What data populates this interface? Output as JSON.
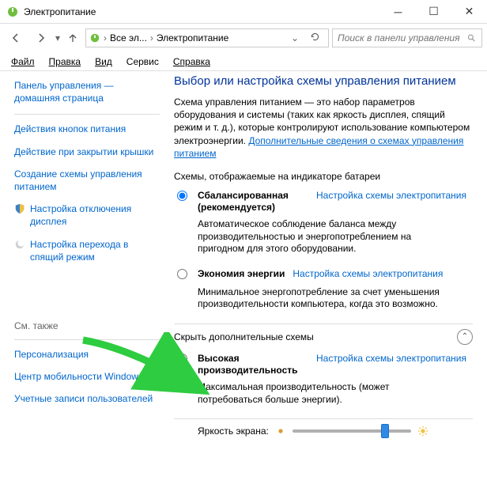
{
  "titlebar": {
    "title": "Электропитание"
  },
  "nav": {
    "breadcrumb1": "Все эл...",
    "breadcrumb2": "Электропитание",
    "search_placeholder": "Поиск в панели управления"
  },
  "menu": {
    "file": "Файл",
    "edit": "Правка",
    "view": "Вид",
    "service": "Сервис",
    "help": "Справка"
  },
  "sidebar": {
    "home": "Панель управления — домашняя страница",
    "links": [
      "Действия кнопок питания",
      "Действие при закрытии крышки",
      "Создание схемы управления питанием",
      "Настройка отключения дисплея",
      "Настройка перехода в спящий режим"
    ],
    "see_also_heading": "См. также",
    "see_also": [
      "Персонализация",
      "Центр мобильности Windows",
      "Учетные записи пользователей"
    ]
  },
  "main": {
    "title": "Выбор или настройка схемы управления питанием",
    "description_prefix": "Схема управления питанием — это набор параметров оборудования и системы (таких как яркость дисплея, спящий режим и т. д.), которые контролируют использование компьютером электроэнергии. ",
    "description_link": "Дополнительные сведения о схемах управления питанием",
    "plans_label": "Схемы, отображаемые на индикаторе батареи",
    "plans": [
      {
        "name": "Сбалансированная (рекомендуется)",
        "link": "Настройка схемы электропитания",
        "desc": "Автоматическое соблюдение баланса между производительностью и энергопотреблением на пригодном для этого оборудовании.",
        "checked": true
      },
      {
        "name": "Экономия энергии",
        "link": "Настройка схемы электропитания",
        "desc": "Минимальное энергопотребление за счет уменьшения производительности компьютера, когда это возможно.",
        "checked": false
      }
    ],
    "collapse_label": "Скрыть дополнительные схемы",
    "extra_plan": {
      "name": "Высокая производительность",
      "link": "Настройка схемы электропитания",
      "desc": "Максимальная производительность (может потребоваться больше энергии).",
      "checked": false
    },
    "brightness_label": "Яркость экрана:",
    "brightness_value_pct": 75
  }
}
